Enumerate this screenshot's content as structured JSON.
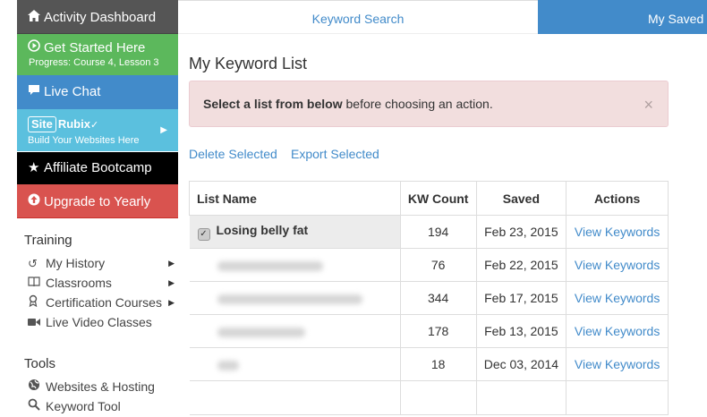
{
  "sidebar": {
    "dashboard": {
      "label": "Activity Dashboard",
      "icon": "home-icon"
    },
    "get_started": {
      "label": "Get Started Here",
      "progress": "Progress: Course 4, Lesson 3",
      "icon": "play-circle-icon"
    },
    "live_chat": {
      "label": "Live Chat",
      "icon": "chat-bubble-icon"
    },
    "siterubix": {
      "logo_box": "Site",
      "logo_text": "Rubix",
      "tagline": "Build Your Websites Here"
    },
    "bootcamp": {
      "label": "Affiliate Bootcamp",
      "icon": "star-icon"
    },
    "upgrade": {
      "label": "Upgrade to Yearly",
      "icon": "up-arrow-circle-icon"
    },
    "training_title": "Training",
    "training_items": [
      {
        "label": "My History",
        "icon": "history-icon"
      },
      {
        "label": "Classrooms",
        "icon": "book-icon"
      },
      {
        "label": "Certification Courses",
        "icon": "award-icon"
      },
      {
        "label": "Live Video Classes",
        "icon": "video-icon"
      }
    ],
    "tools_title": "Tools",
    "tools_items": [
      {
        "label": "Websites & Hosting",
        "icon": "globe-icon"
      },
      {
        "label": "Keyword Tool",
        "icon": "search-icon"
      }
    ]
  },
  "topnav": {
    "keyword_search": "Keyword Search",
    "my_saved": "My Saved Lists"
  },
  "main": {
    "title": "My Keyword List",
    "alert": {
      "bold": "Select a list from below",
      "rest": " before choosing an action.",
      "close": "×"
    },
    "delete_selected": "Delete Selected",
    "export_selected": "Export Selected",
    "table": {
      "headers": [
        "List Name",
        "KW Count",
        "Saved",
        "Actions"
      ],
      "rows": [
        {
          "name": "Losing belly fat",
          "count": "194",
          "saved": "Feb 23, 2015",
          "action": "View Keywords"
        },
        {
          "name": "",
          "count": "76",
          "saved": "Feb 22, 2015",
          "action": "View Keywords"
        },
        {
          "name": "",
          "count": "344",
          "saved": "Feb 17, 2015",
          "action": "View Keywords"
        },
        {
          "name": "",
          "count": "178",
          "saved": "Feb 13, 2015",
          "action": "View Keywords"
        },
        {
          "name": "",
          "count": "18",
          "saved": "Dec 03, 2014",
          "action": "View Keywords"
        }
      ]
    }
  },
  "colors": {
    "primary": "#428bca",
    "success": "#5cb85c",
    "info": "#5bc0de",
    "danger": "#d9534f",
    "alert_bg": "#f2dede"
  }
}
